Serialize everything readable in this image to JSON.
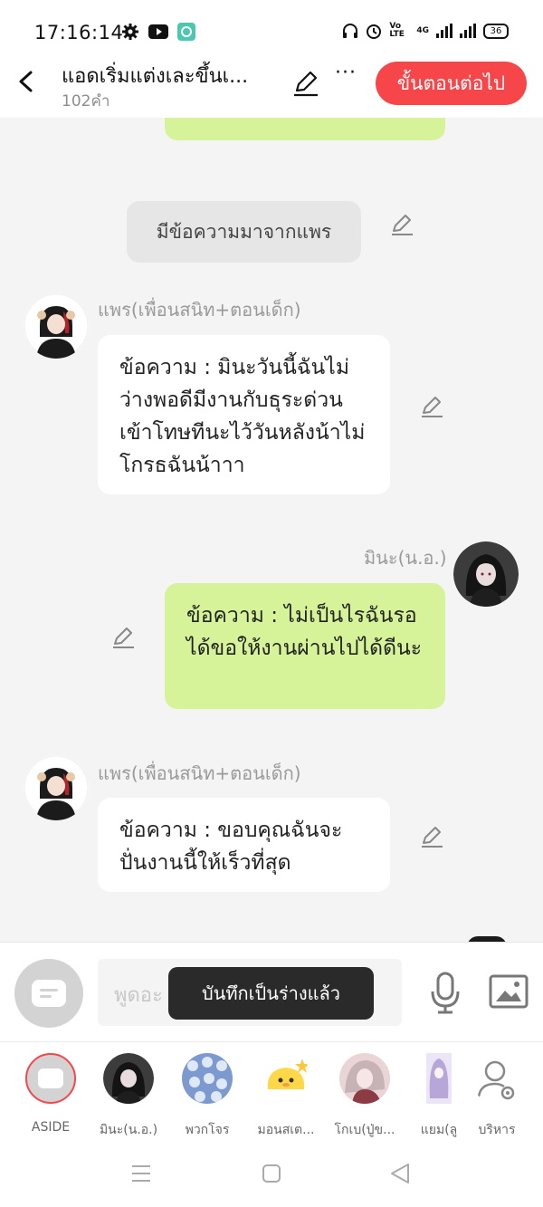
{
  "status_bar": {
    "time": "17:16:14",
    "volte_label": "Vo LTE",
    "network_label": "4G",
    "battery": "36",
    "icons_left": [
      "gear-icon",
      "youtube-icon",
      "app-icon"
    ],
    "icons_right": [
      "headphones-icon",
      "alarm-icon",
      "volte-icon",
      "signal-icon",
      "signal-icon",
      "battery-icon"
    ]
  },
  "header": {
    "title": "แอดเริ่มแต่งเละขึ้นเ...",
    "word_count": "102คำ",
    "more_label": "···",
    "next_button": "ขั้นตอนต่อไป"
  },
  "chat": {
    "narration": "มีข้อความมาจากแพร",
    "messages": [
      {
        "sender": "แพร(เพื่อนสนิท+ตอนเด็ก)",
        "side": "left",
        "text": "ข้อความ : มินะวันนี้ฉันไม่ว่างพอดีมีงานกับธุระด่วนเข้าโทษทีนะไว้วันหลังน้าไม่โกรธฉันน้าาา"
      },
      {
        "sender": "มินะ(น.อ.)",
        "side": "right",
        "text": "ข้อความ : ไม่เป็นไรฉันรอได้ขอให้งานผ่านไปได้ดีนะ"
      },
      {
        "sender": "แพร(เพื่อนสนิท+ตอนเด็ก)",
        "side": "left",
        "text": "ข้อความ : ขอบคุณฉันจะปั่นงานนี้ให้เร็วที่สุด"
      }
    ]
  },
  "composer": {
    "placeholder": "พูดอะ",
    "toast": "บันทึกเป็นร่างแล้ว"
  },
  "characters": [
    {
      "label": "ASIDE"
    },
    {
      "label": "มินะ(น.อ.)"
    },
    {
      "label": "พวกโจร"
    },
    {
      "label": "มอนสเต..."
    },
    {
      "label": "โกเบ(ปู่ข..."
    },
    {
      "label": "แยม(ลู"
    },
    {
      "label": "บริหาร"
    }
  ],
  "colors": {
    "accent": "#f6464a",
    "green_bubble": "#d6f39a",
    "background": "#f4f4f4"
  }
}
